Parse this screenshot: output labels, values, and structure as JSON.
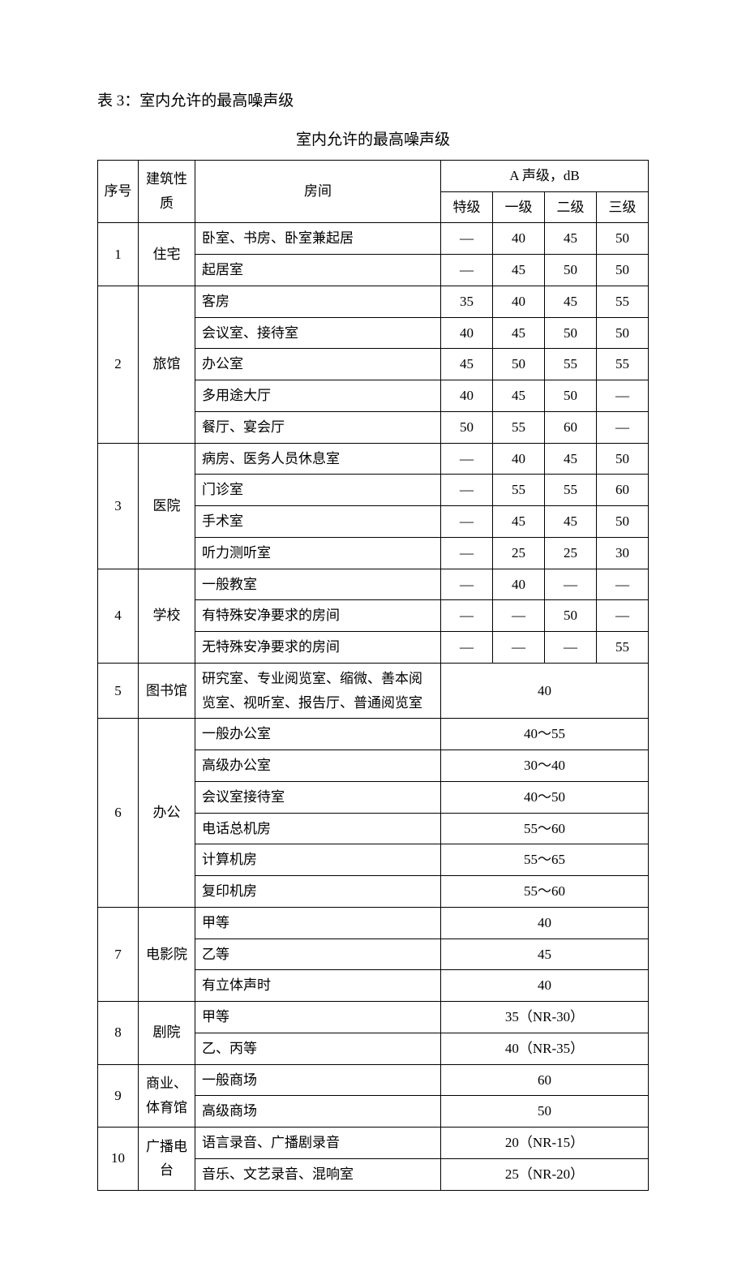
{
  "caption": "表 3：室内允许的最高噪声级",
  "title": "室内允许的最高噪声级",
  "head": {
    "idx": "序号",
    "cat": "建筑性质",
    "room": "房间",
    "group": "A 声级，dB",
    "lv0": "特级",
    "lv1": "一级",
    "lv2": "二级",
    "lv3": "三级"
  },
  "rows": [
    {
      "idx": "1",
      "idxRowspan": 2,
      "cat": "住宅",
      "catRowspan": 2,
      "room": "卧室、书房、卧室兼起居",
      "vals": [
        "—",
        "40",
        "45",
        "50"
      ]
    },
    {
      "room": "起居室",
      "vals": [
        "—",
        "45",
        "50",
        "50"
      ]
    },
    {
      "idx": "2",
      "idxRowspan": 5,
      "cat": "旅馆",
      "catRowspan": 5,
      "room": "客房",
      "vals": [
        "35",
        "40",
        "45",
        "55"
      ]
    },
    {
      "room": "会议室、接待室",
      "vals": [
        "40",
        "45",
        "50",
        "50"
      ]
    },
    {
      "room": "办公室",
      "vals": [
        "45",
        "50",
        "55",
        "55"
      ]
    },
    {
      "room": "多用途大厅",
      "vals": [
        "40",
        "45",
        "50",
        "—"
      ]
    },
    {
      "room": "餐厅、宴会厅",
      "vals": [
        "50",
        "55",
        "60",
        "—"
      ]
    },
    {
      "idx": "3",
      "idxRowspan": 4,
      "cat": "医院",
      "catRowspan": 4,
      "room": "病房、医务人员休息室",
      "vals": [
        "—",
        "40",
        "45",
        "50"
      ]
    },
    {
      "room": "门诊室",
      "vals": [
        "—",
        "55",
        "55",
        "60"
      ]
    },
    {
      "room": "手术室",
      "vals": [
        "—",
        "45",
        "45",
        "50"
      ]
    },
    {
      "room": "听力测听室",
      "vals": [
        "—",
        "25",
        "25",
        "30"
      ]
    },
    {
      "idx": "4",
      "idxRowspan": 3,
      "cat": "学校",
      "catRowspan": 3,
      "room": "一般教室",
      "vals": [
        "—",
        "40",
        "—",
        "—"
      ]
    },
    {
      "room": "有特殊安净要求的房间",
      "vals": [
        "—",
        "—",
        "50",
        "—"
      ]
    },
    {
      "room": "无特殊安净要求的房间",
      "vals": [
        "—",
        "—",
        "—",
        "55"
      ]
    },
    {
      "idx": "5",
      "idxRowspan": 1,
      "cat": "图书馆",
      "catRowspan": 1,
      "room": "研究室、专业阅览室、缩微、善本阅览室、视听室、报告厅、普通阅览室",
      "merged": "40"
    },
    {
      "idx": "6",
      "idxRowspan": 6,
      "cat": "办公",
      "catRowspan": 6,
      "room": "一般办公室",
      "merged": "40～55"
    },
    {
      "room": "高级办公室",
      "merged": "30～40"
    },
    {
      "room": "会议室接待室",
      "merged": "40～50"
    },
    {
      "room": "电话总机房",
      "merged": "55～60"
    },
    {
      "room": "计算机房",
      "merged": "55～65"
    },
    {
      "room": "复印机房",
      "merged": "55～60"
    },
    {
      "idx": "7",
      "idxRowspan": 3,
      "cat": "电影院",
      "catRowspan": 3,
      "room": "甲等",
      "merged": "40"
    },
    {
      "room": "乙等",
      "merged": "45"
    },
    {
      "room": "有立体声时",
      "merged": "40"
    },
    {
      "idx": "8",
      "idxRowspan": 2,
      "cat": "剧院",
      "catRowspan": 2,
      "room": "甲等",
      "merged": "35（NR-30）"
    },
    {
      "room": "乙、丙等",
      "merged": "40（NR-35）"
    },
    {
      "idx": "9",
      "idxRowspan": 2,
      "cat": "商业、体育馆",
      "catRowspan": 2,
      "room": "一般商场",
      "merged": "60"
    },
    {
      "room": "高级商场",
      "merged": "50"
    },
    {
      "idx": "10",
      "idxRowspan": 2,
      "cat": "广播电台",
      "catRowspan": 2,
      "room": "语言录音、广播剧录音",
      "merged": "20（NR-15）"
    },
    {
      "room": "音乐、文艺录音、混响室",
      "merged": "25（NR-20）"
    }
  ]
}
